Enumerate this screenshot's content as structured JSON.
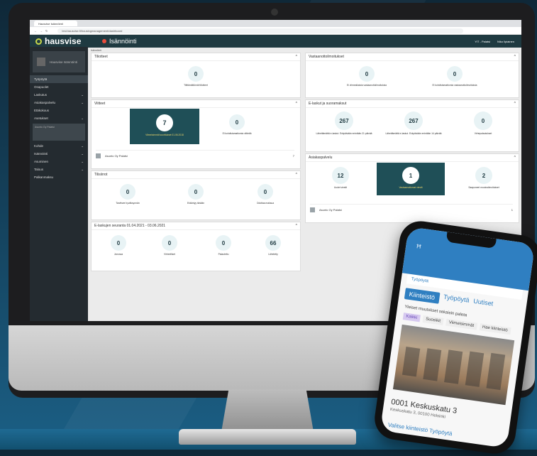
{
  "browser": {
    "tab_title": "Hausvise Isännöinti",
    "address": "test.hausvise.fi/housingmanagement/dashboard"
  },
  "app": {
    "logo": "hausvise",
    "title": "Isännöinti",
    "company": "YIT - Palatsi",
    "user": "Niko Ilpiainen",
    "breadcrumb": "Isännöinti"
  },
  "sidebar": {
    "profile_name": "Hausvise Isännöinti",
    "items": [
      {
        "label": "Työpöytä"
      },
      {
        "label": "Osapuolet"
      },
      {
        "label": "Laskutus"
      },
      {
        "label": "Asiakaspalvelu"
      },
      {
        "label": "Etäkokous"
      },
      {
        "label": "Asetukset"
      },
      {
        "label": "Kohde"
      },
      {
        "label": "Isännöinti"
      },
      {
        "label": "Asuminen"
      },
      {
        "label": "Talous"
      },
      {
        "label": "Palkanmaksu"
      }
    ],
    "subcard": "Asunto Oy Palatsi"
  },
  "cards": {
    "tiliotteet": {
      "title": "Tiliotteet",
      "metric_value": "0",
      "metric_label": "Tilittämättömät tiliotteet"
    },
    "viitteet": {
      "title": "Viitteet",
      "m1_value": "7",
      "m1_label": "Viimeisimmät suoritukset 01.06.2018",
      "m2_value": "0",
      "m2_label": "Ei kohdistamattomia viitteitä",
      "row_name": "Asunto Oy Palatsi",
      "row_value": "7"
    },
    "tilisiirrot": {
      "title": "Tilisiirrot",
      "metrics": [
        {
          "value": "0",
          "label": "Tarvitsee hyväksynnän"
        },
        {
          "value": "0",
          "label": "Erääntyy tänään"
        },
        {
          "value": "0",
          "label": "Odottaa maksua"
        }
      ]
    },
    "elaskujen": {
      "title": "E-laskujen seuranta 01.04.2021 - 03.06.2021",
      "metrics": [
        {
          "value": "0",
          "label": "Jonossa"
        },
        {
          "value": "0",
          "label": "Virheelliset"
        },
        {
          "value": "0",
          "label": "Palautettu"
        },
        {
          "value": "66",
          "label": "Lähetetty"
        }
      ]
    },
    "vastaanotto": {
      "title": "Vastaanottoilmoitukset",
      "metrics": [
        {
          "value": "0",
          "label": "Ei viimeaikaisia vastaanottoilmoituksia"
        },
        {
          "value": "0",
          "label": "Ei kohdistamattomia vastaanottoilmoituksia"
        }
      ]
    },
    "suoramaksut": {
      "title": "E-laskut ja suoramaksut",
      "metrics": [
        {
          "value": "267",
          "label": "Lähettämättä e-laskut. Eräpäivään enintään 21 päivää"
        },
        {
          "value": "267",
          "label": "Lähettämättä e-laskut. Eräpäivään enintään 14 päivää"
        },
        {
          "value": "0",
          "label": "Virhepalautukset"
        }
      ]
    },
    "asiakaspalvelu": {
      "title": "Asiakaspalvelu",
      "m1_value": "12",
      "m1_label": "Uudet viestit",
      "m2_value": "1",
      "m2_label": "Vastaamattomat viestit",
      "m3_value": "2",
      "m3_label": "Saapuneet muutosilmoitukset",
      "row_name": "Asunto Oy Palatsi",
      "row_value": "1"
    }
  },
  "phone": {
    "sub": "Työpöytä",
    "tabs": [
      "Kiinteistö",
      "Työpöytä",
      "Uutiset"
    ],
    "text": "Yleiset muutokset sekaisin paleta",
    "chips": [
      "Kaikki",
      "Suosikit",
      "Viimeisimmät",
      "Hae kiinteistö"
    ],
    "address": "0001 Keskuskatu 3",
    "address2": "Keskuskatu 3, 00100 Helsinki",
    "link": "Valitse kiinteistö Työpöytä"
  },
  "colors": {
    "primary": "#1f3a41",
    "accent": "#c8d84a",
    "highlight": "#1f4f57",
    "mobile": "#2f7fc1"
  }
}
